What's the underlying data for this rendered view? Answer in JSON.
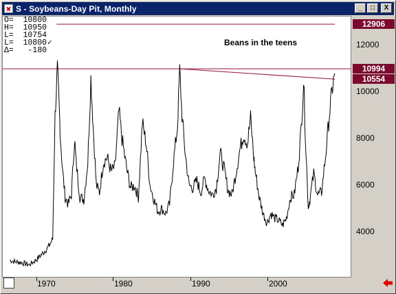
{
  "window": {
    "title": "S - Soybeans-Day Pit, Monthly",
    "controls": [
      "_",
      "□",
      "X"
    ]
  },
  "readout": [
    {
      "key": "O=",
      "value": "10800",
      "mark": ""
    },
    {
      "key": "H=",
      "value": "10950",
      "mark": ""
    },
    {
      "key": "L=",
      "value": "10754",
      "mark": ""
    },
    {
      "key": "L=",
      "value": "10800",
      "mark": "✓"
    },
    {
      "key": "Δ=",
      "value": "-180",
      "mark": ""
    }
  ],
  "annotation": "Beans in the teens",
  "price_axis": {
    "labels": [
      "12000",
      "10000",
      "8000",
      "6000",
      "4000"
    ],
    "tags": [
      "12906",
      "10994",
      "10554"
    ],
    "tag_color": "#7a0a2e"
  },
  "date_axis": {
    "labels": [
      "1970",
      "1980",
      "1990",
      "2000"
    ]
  },
  "colors": {
    "price_line": "#000000",
    "line_color": "#a0285a",
    "title_bar": "#0a246a",
    "arrow": "#e00000"
  },
  "chart_data": {
    "type": "line",
    "ylim": [
      2600,
      13600
    ],
    "series": [
      {
        "values": [
          [
            1966.5,
            2800
          ],
          [
            1967,
            2750
          ],
          [
            1968,
            2700
          ],
          [
            1969,
            2600
          ],
          [
            1970,
            2850
          ],
          [
            1971,
            3200
          ],
          [
            1971.5,
            3400
          ],
          [
            1972,
            3700
          ],
          [
            1972.3,
            9000
          ],
          [
            1972.6,
            11000
          ],
          [
            1972.8,
            9600
          ],
          [
            1973,
            8000
          ],
          [
            1973.3,
            6500
          ],
          [
            1973.6,
            5500
          ],
          [
            1974,
            5200
          ],
          [
            1974.4,
            5600
          ],
          [
            1974.8,
            8000
          ],
          [
            1975,
            7000
          ],
          [
            1975.5,
            5500
          ],
          [
            1976,
            5400
          ],
          [
            1976.5,
            7000
          ],
          [
            1976.9,
            10600
          ],
          [
            1977.2,
            8500
          ],
          [
            1977.6,
            6000
          ],
          [
            1978,
            5700
          ],
          [
            1978.5,
            7000
          ],
          [
            1979,
            7200
          ],
          [
            1979.5,
            6600
          ],
          [
            1980,
            6800
          ],
          [
            1980.5,
            9200
          ],
          [
            1980.9,
            8000
          ],
          [
            1981.5,
            6700
          ],
          [
            1982,
            5900
          ],
          [
            1982.5,
            6000
          ],
          [
            1983,
            5500
          ],
          [
            1983.5,
            8700
          ],
          [
            1984,
            7800
          ],
          [
            1984.5,
            6000
          ],
          [
            1985,
            5400
          ],
          [
            1985.5,
            4900
          ],
          [
            1986,
            5000
          ],
          [
            1986.5,
            4800
          ],
          [
            1987,
            5200
          ],
          [
            1987.5,
            7000
          ],
          [
            1988,
            8500
          ],
          [
            1988.3,
            10900
          ],
          [
            1988.6,
            9000
          ],
          [
            1989,
            7400
          ],
          [
            1989.5,
            6000
          ],
          [
            1990,
            5900
          ],
          [
            1990.5,
            6200
          ],
          [
            1991,
            5700
          ],
          [
            1991.5,
            6300
          ],
          [
            1992,
            5800
          ],
          [
            1992.5,
            5600
          ],
          [
            1993,
            5900
          ],
          [
            1993.5,
            7400
          ],
          [
            1994,
            6700
          ],
          [
            1994.5,
            5800
          ],
          [
            1995,
            5600
          ],
          [
            1995.5,
            6500
          ],
          [
            1996,
            7500
          ],
          [
            1996.5,
            8200
          ],
          [
            1997,
            7800
          ],
          [
            1997.4,
            8900
          ],
          [
            1997.8,
            7200
          ],
          [
            1998,
            6600
          ],
          [
            1998.5,
            5500
          ],
          [
            1999,
            4800
          ],
          [
            1999.5,
            4400
          ],
          [
            2000,
            4800
          ],
          [
            2000.5,
            4600
          ],
          [
            2001,
            4500
          ],
          [
            2001.5,
            4300
          ],
          [
            2002,
            4600
          ],
          [
            2002.5,
            5500
          ],
          [
            2003,
            5600
          ],
          [
            2003.5,
            6800
          ],
          [
            2003.9,
            8500
          ],
          [
            2004.2,
            10500
          ],
          [
            2004.5,
            7500
          ],
          [
            2004.8,
            5100
          ],
          [
            2005,
            5400
          ],
          [
            2005.5,
            6500
          ],
          [
            2006,
            5600
          ],
          [
            2006.5,
            5700
          ],
          [
            2007,
            7200
          ],
          [
            2007.5,
            9000
          ],
          [
            2007.9,
            10200
          ],
          [
            2008.2,
            10800
          ]
        ]
      }
    ],
    "reference_lines": [
      {
        "type": "horizontal",
        "value": 12906
      },
      {
        "type": "horizontal",
        "value": 10994
      },
      {
        "type": "trend",
        "from": [
          1988.3,
          10994
        ],
        "to": [
          2008.2,
          10554
        ]
      }
    ]
  }
}
